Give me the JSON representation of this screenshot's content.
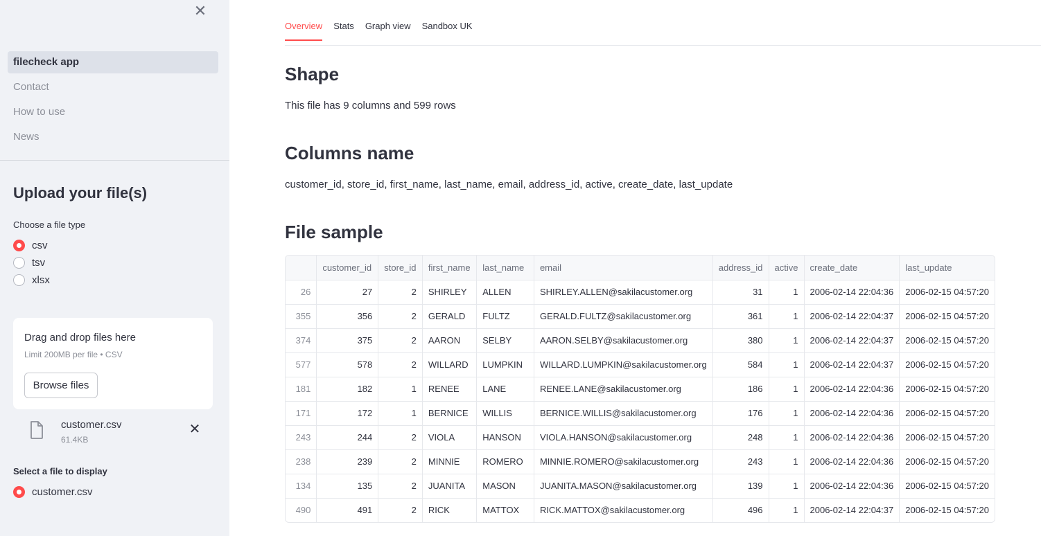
{
  "sidebar": {
    "nav": [
      "filecheck app",
      "Contact",
      "How to use",
      "News"
    ],
    "upload_title": "Upload your file(s)",
    "file_type_label": "Choose a file type",
    "file_types": [
      "csv",
      "tsv",
      "xlsx"
    ],
    "selected_file_type": "csv",
    "dropzone": {
      "title": "Drag and drop files here",
      "subtitle": "Limit 200MB per file • CSV",
      "browse_label": "Browse files"
    },
    "uploaded_file": {
      "name": "customer.csv",
      "size": "61.4KB"
    },
    "select_label": "Select a file to display",
    "select_option": "customer.csv"
  },
  "tabs": [
    "Overview",
    "Stats",
    "Graph view",
    "Sandbox UK"
  ],
  "active_tab": "Overview",
  "main": {
    "shape_heading": "Shape",
    "shape_text": "This file has 9 columns and 599 rows",
    "columns_heading": "Columns name",
    "columns_text": "customer_id, store_id, first_name, last_name, email, address_id, active, create_date, last_update",
    "sample_heading": "File sample"
  },
  "table": {
    "headers": [
      "",
      "customer_id",
      "store_id",
      "first_name",
      "last_name",
      "email",
      "address_id",
      "active",
      "create_date",
      "last_update"
    ],
    "rows": [
      [
        "26",
        "27",
        "2",
        "SHIRLEY",
        "ALLEN",
        "SHIRLEY.ALLEN@sakilacustomer.org",
        "31",
        "1",
        "2006-02-14 22:04:36",
        "2006-02-15 04:57:20"
      ],
      [
        "355",
        "356",
        "2",
        "GERALD",
        "FULTZ",
        "GERALD.FULTZ@sakilacustomer.org",
        "361",
        "1",
        "2006-02-14 22:04:37",
        "2006-02-15 04:57:20"
      ],
      [
        "374",
        "375",
        "2",
        "AARON",
        "SELBY",
        "AARON.SELBY@sakilacustomer.org",
        "380",
        "1",
        "2006-02-14 22:04:37",
        "2006-02-15 04:57:20"
      ],
      [
        "577",
        "578",
        "2",
        "WILLARD",
        "LUMPKIN",
        "WILLARD.LUMPKIN@sakilacustomer.org",
        "584",
        "1",
        "2006-02-14 22:04:37",
        "2006-02-15 04:57:20"
      ],
      [
        "181",
        "182",
        "1",
        "RENEE",
        "LANE",
        "RENEE.LANE@sakilacustomer.org",
        "186",
        "1",
        "2006-02-14 22:04:36",
        "2006-02-15 04:57:20"
      ],
      [
        "171",
        "172",
        "1",
        "BERNICE",
        "WILLIS",
        "BERNICE.WILLIS@sakilacustomer.org",
        "176",
        "1",
        "2006-02-14 22:04:36",
        "2006-02-15 04:57:20"
      ],
      [
        "243",
        "244",
        "2",
        "VIOLA",
        "HANSON",
        "VIOLA.HANSON@sakilacustomer.org",
        "248",
        "1",
        "2006-02-14 22:04:36",
        "2006-02-15 04:57:20"
      ],
      [
        "238",
        "239",
        "2",
        "MINNIE",
        "ROMERO",
        "MINNIE.ROMERO@sakilacustomer.org",
        "243",
        "1",
        "2006-02-14 22:04:36",
        "2006-02-15 04:57:20"
      ],
      [
        "134",
        "135",
        "2",
        "JUANITA",
        "MASON",
        "JUANITA.MASON@sakilacustomer.org",
        "139",
        "1",
        "2006-02-14 22:04:36",
        "2006-02-15 04:57:20"
      ],
      [
        "490",
        "491",
        "2",
        "RICK",
        "MATTOX",
        "RICK.MATTOX@sakilacustomer.org",
        "496",
        "1",
        "2006-02-14 22:04:37",
        "2006-02-15 04:57:20"
      ]
    ]
  },
  "colors": {
    "accent": "#ff4b4b",
    "sidebar_bg": "#f0f2f6",
    "text": "#31333f"
  }
}
